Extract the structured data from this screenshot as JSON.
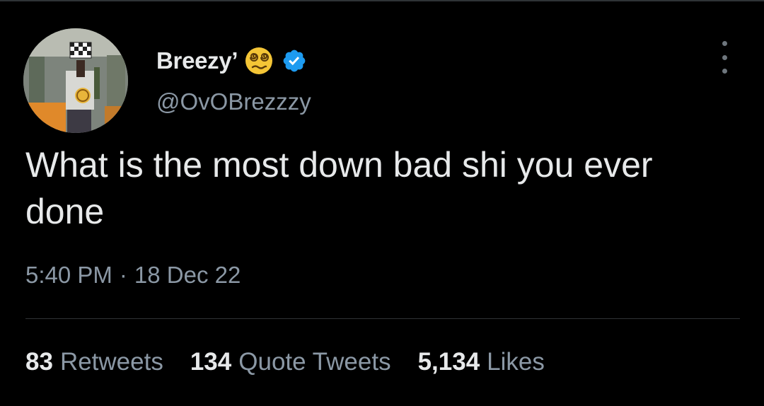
{
  "tweet": {
    "display_name": "Breezy’",
    "handle": "@OvOBrezzzy",
    "text": "What is the most down bad shi you ever done",
    "time": "5:40 PM",
    "separator": "·",
    "date": "18 Dec 22"
  },
  "stats": {
    "retweets_count": "83",
    "retweets_label": "Retweets",
    "quotes_count": "134",
    "quotes_label": "Quote Tweets",
    "likes_count": "5,134",
    "likes_label": "Likes"
  },
  "icons": {
    "emoji": "dizzy-face-emoji-icon",
    "verified": "verified-badge-icon",
    "more": "more-options-icon"
  },
  "colors": {
    "background": "#000000",
    "primary_text": "#e7e9ea",
    "secondary_text": "#8b98a5",
    "verified_blue": "#1d9bf0",
    "divider": "#2f3336"
  }
}
